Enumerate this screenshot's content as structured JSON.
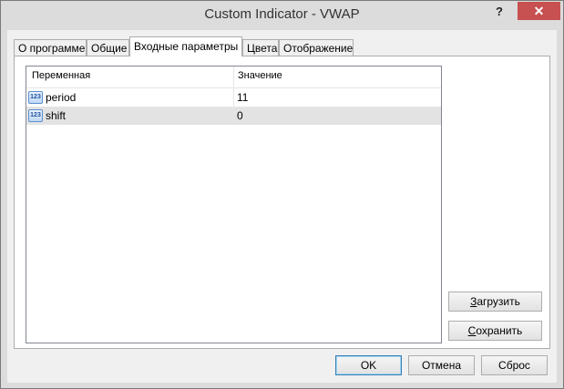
{
  "window": {
    "title": "Custom Indicator - VWAP",
    "help_label": "?",
    "close_label": "✕"
  },
  "tabs": [
    {
      "label": "О программе"
    },
    {
      "label": "Общие"
    },
    {
      "label": "Входные параметры",
      "active": true
    },
    {
      "label": "Цвета"
    },
    {
      "label": "Отображение"
    }
  ],
  "grid": {
    "columns": [
      "Переменная",
      "Значение"
    ],
    "rows": [
      {
        "icon": "123",
        "name": "period",
        "value": "11"
      },
      {
        "icon": "123",
        "name": "shift",
        "value": "0",
        "selected": true
      }
    ]
  },
  "side_buttons": {
    "load_hotkey": "З",
    "load_rest": "агрузить",
    "save_hotkey": "С",
    "save_rest": "охранить"
  },
  "buttons": {
    "ok": "OK",
    "cancel": "Отмена",
    "reset": "Сброс"
  }
}
